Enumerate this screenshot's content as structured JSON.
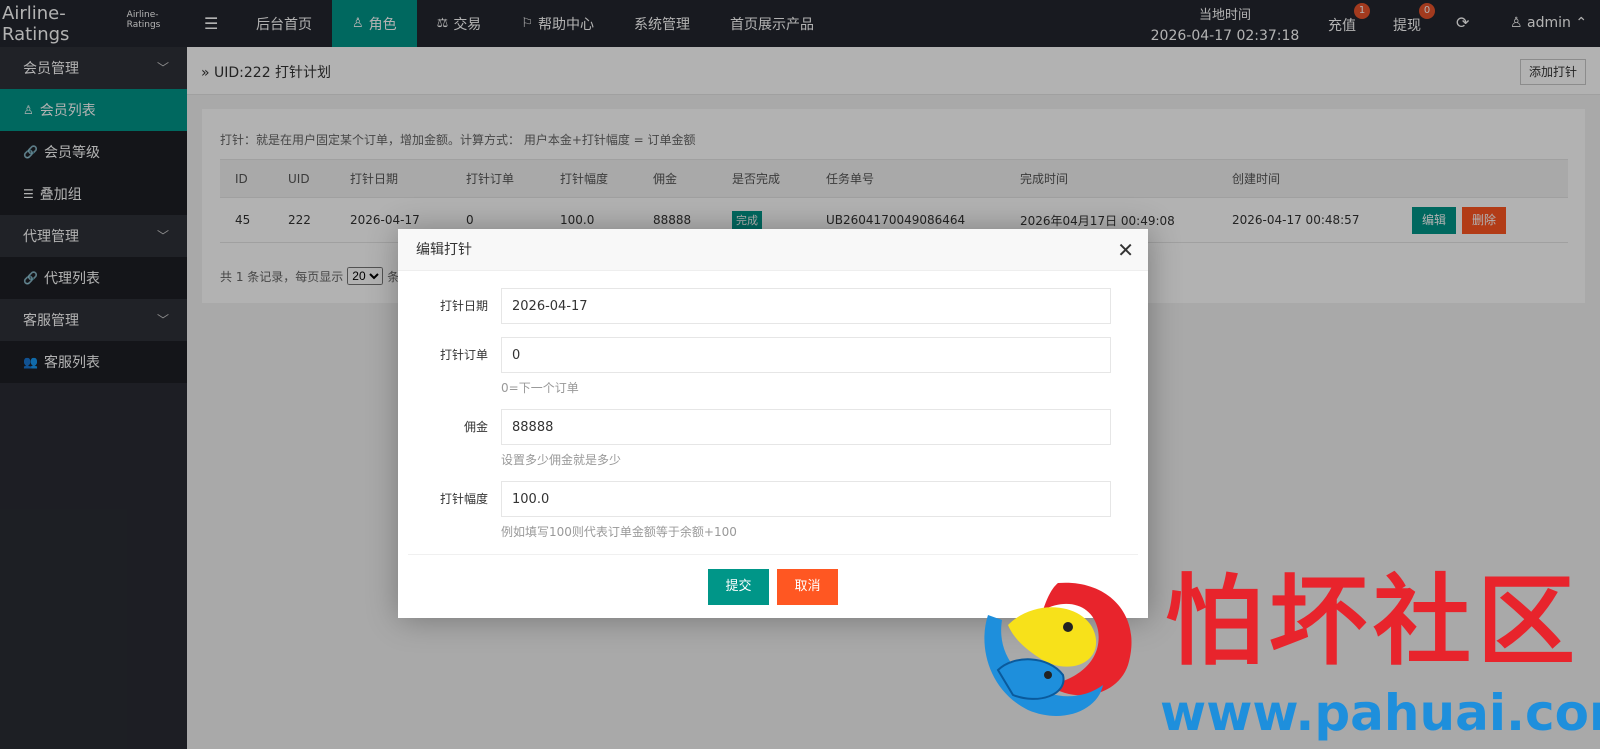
{
  "header": {
    "logo_main": "Airline-Ratings",
    "logo_sub": "Airline-Ratings",
    "nav": [
      {
        "label": "后台首页",
        "icon": ""
      },
      {
        "label": "角色",
        "icon": "user-icon"
      },
      {
        "label": "交易",
        "icon": "scale-icon"
      },
      {
        "label": "帮助中心",
        "icon": "flag-icon"
      },
      {
        "label": "系统管理",
        "icon": ""
      },
      {
        "label": "首页展示产品",
        "icon": ""
      }
    ],
    "clock_label": "当地时间",
    "clock_value": "2026-04-17 02:37:18",
    "recharge_label": "充值",
    "recharge_badge": "1",
    "withdraw_label": "提现",
    "withdraw_badge": "0",
    "admin_label": "admin"
  },
  "sidebar": {
    "groups": [
      {
        "label": "会员管理",
        "items": [
          {
            "label": "会员列表",
            "icon": "user-icon"
          },
          {
            "label": "会员等级",
            "icon": "link-icon"
          },
          {
            "label": "叠加组",
            "icon": "list-icon"
          }
        ]
      },
      {
        "label": "代理管理",
        "items": [
          {
            "label": "代理列表",
            "icon": "link-icon"
          }
        ]
      },
      {
        "label": "客服管理",
        "items": [
          {
            "label": "客服列表",
            "icon": "users-icon"
          }
        ]
      }
    ]
  },
  "page": {
    "breadcrumb": "UID:222 打针计划",
    "add_button": "添加打针",
    "tip": "打针：就是在用户固定某个订单，增加金额。计算方式： 用户本金+打针幅度 = 订单金额",
    "table": {
      "headers": [
        "ID",
        "UID",
        "打针日期",
        "打针订单",
        "打针幅度",
        "佣金",
        "是否完成",
        "任务单号",
        "完成时间",
        "创建时间",
        ""
      ],
      "rows": [
        {
          "id": "45",
          "uid": "222",
          "date": "2026-04-17",
          "order": "0",
          "range": "100.0",
          "commission": "88888",
          "status": "完成",
          "task_no": "UB2604170049086464",
          "done_time": "2026年04月17日 00:49:08",
          "created": "2026-04-17 00:48:57",
          "edit": "编辑",
          "delete": "删除"
        }
      ]
    },
    "pager": {
      "prefix": "共 1 条记录，每页显示",
      "per_page": "20",
      "suffix": "条,"
    }
  },
  "modal": {
    "title": "编辑打针",
    "fields": [
      {
        "label": "打针日期",
        "value": "2026-04-17",
        "hint": ""
      },
      {
        "label": "打针订单",
        "value": "0",
        "hint": "0=下一个订单"
      },
      {
        "label": "佣金",
        "value": "88888",
        "hint": "设置多少佣金就是多少"
      },
      {
        "label": "打针幅度",
        "value": "100.0",
        "hint": "例如填写100则代表订单金额等于余额+100"
      }
    ],
    "submit": "提交",
    "cancel": "取消"
  },
  "watermark": {
    "text": "怕坏社区",
    "url": "www.pahuai.com"
  }
}
